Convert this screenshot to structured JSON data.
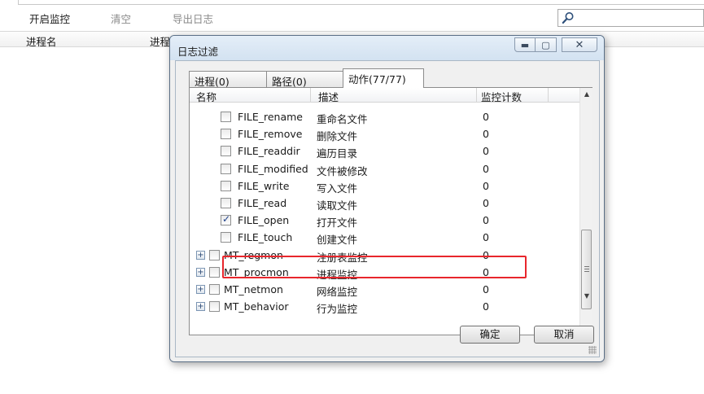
{
  "toolbar": {
    "start_monitor": "开启监控",
    "clear": "清空",
    "export_log": "导出日志",
    "search_placeholder": ""
  },
  "columns": {
    "process_name": "进程名",
    "process_id": "进程"
  },
  "dialog": {
    "title": "日志过滤",
    "tabs": [
      {
        "label": "进程(0)"
      },
      {
        "label": "路径(0)"
      },
      {
        "label": "动作(77/77)"
      }
    ],
    "list_headers": {
      "name": "名称",
      "desc": "描述",
      "count": "监控计数"
    },
    "rows": [
      {
        "name": "FILE_rename",
        "desc": "重命名文件",
        "count": "0",
        "checked": false,
        "group": false
      },
      {
        "name": "FILE_remove",
        "desc": "删除文件",
        "count": "0",
        "checked": false,
        "group": false
      },
      {
        "name": "FILE_readdir",
        "desc": "遍历目录",
        "count": "0",
        "checked": false,
        "group": false
      },
      {
        "name": "FILE_modified",
        "desc": "文件被修改",
        "count": "0",
        "checked": false,
        "group": false
      },
      {
        "name": "FILE_write",
        "desc": "写入文件",
        "count": "0",
        "checked": false,
        "group": false
      },
      {
        "name": "FILE_read",
        "desc": "读取文件",
        "count": "0",
        "checked": false,
        "group": false
      },
      {
        "name": "FILE_open",
        "desc": "打开文件",
        "count": "0",
        "checked": true,
        "group": false
      },
      {
        "name": "FILE_touch",
        "desc": "创建文件",
        "count": "0",
        "checked": false,
        "group": false
      },
      {
        "name": "MT_regmon",
        "desc": "注册表监控",
        "count": "0",
        "checked": false,
        "group": true
      },
      {
        "name": "MT_procmon",
        "desc": "进程监控",
        "count": "0",
        "checked": false,
        "group": true
      },
      {
        "name": "MT_netmon",
        "desc": "网络监控",
        "count": "0",
        "checked": false,
        "group": true
      },
      {
        "name": "MT_behavior",
        "desc": "行为监控",
        "count": "0",
        "checked": false,
        "group": true
      }
    ],
    "ok": "确定",
    "cancel": "取消"
  },
  "icons": {
    "search": "magnifier-icon",
    "minimize": "minimize-icon",
    "maximize": "maximize-icon",
    "close": "close-icon",
    "expand": "plus-expand-icon"
  },
  "colors": {
    "highlight_border": "#e8262c",
    "dialog_frame": "#d6e4f2"
  }
}
